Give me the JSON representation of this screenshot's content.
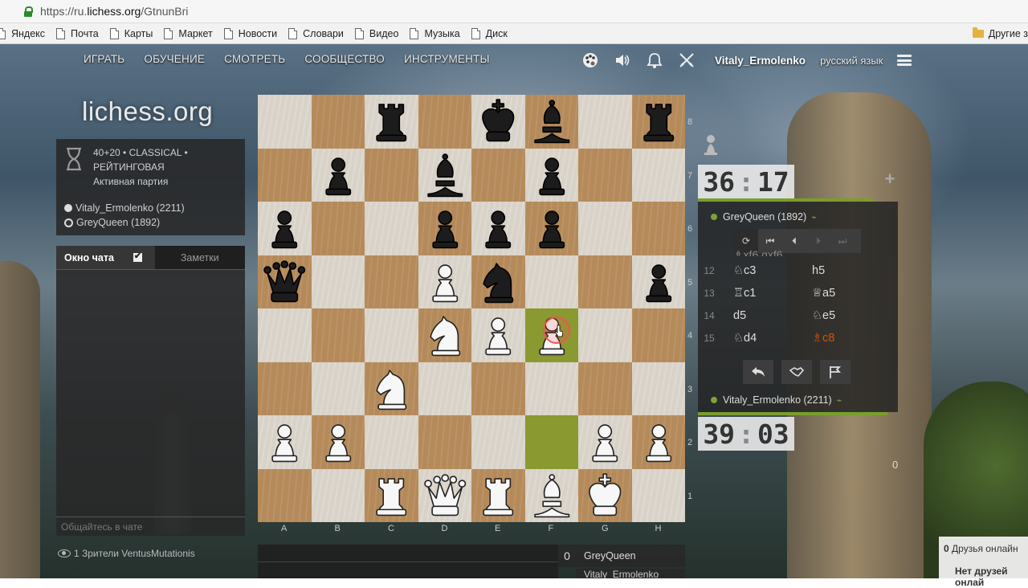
{
  "browser": {
    "url_scheme": "https://ru.",
    "url_host": "lichess.org",
    "url_path": "/GtnunBri",
    "bookmarks": [
      "Яндекс",
      "Почта",
      "Карты",
      "Маркет",
      "Новости",
      "Словари",
      "Видео",
      "Музыка",
      "Диск"
    ],
    "other_bookmarks": "Другие з"
  },
  "nav": {
    "items": [
      "ИГРАТЬ",
      "ОБУЧЕНИЕ",
      "СМОТРЕТЬ",
      "СООБЩЕСТВО",
      "ИНСТРУМЕНТЫ"
    ],
    "username": "Vitaly_Ermolenko",
    "language": "русский язык"
  },
  "logo": "lichess.org",
  "game_info": {
    "line1": "40+20 • CLASSICAL •",
    "line2": "РЕЙТИНГОВАЯ",
    "line3": "Активная партия",
    "white_player": "Vitaly_Ermolenko (2211)",
    "black_player": "GreyQueen (1892)"
  },
  "chat": {
    "tab_chat": "Окно чата",
    "tab_notes": "Заметки",
    "placeholder": "Общайтесь в чате",
    "watchers": "1 Зрители VentusMutationis"
  },
  "board": {
    "ranks": [
      "8",
      "7",
      "6",
      "5",
      "4",
      "3",
      "2",
      "1"
    ],
    "files": [
      "A",
      "B",
      "C",
      "D",
      "E",
      "F",
      "G",
      "H"
    ],
    "rows": [
      [
        "",
        "",
        "bR",
        "",
        "bK",
        "bB",
        "",
        "bR"
      ],
      [
        "",
        "bP",
        "",
        "bB",
        "",
        "bP",
        "",
        ""
      ],
      [
        "bP",
        "",
        "",
        "bP",
        "bP",
        "bP",
        "",
        ""
      ],
      [
        "bQ",
        "",
        "",
        "wP",
        "bN",
        "",
        "",
        "bP"
      ],
      [
        "",
        "",
        "",
        "wN",
        "wP",
        "wP",
        "",
        ""
      ],
      [
        "",
        "",
        "wN",
        "",
        "",
        "",
        "",
        ""
      ],
      [
        "wP",
        "wP",
        "",
        "",
        "",
        "",
        "wP",
        "wP"
      ],
      [
        "",
        "",
        "wR",
        "wQ",
        "wR",
        "wB",
        "wK",
        ""
      ]
    ],
    "highlights": [
      "f4",
      "f2"
    ]
  },
  "opponent": {
    "name": "GreyQueen (1892)",
    "clock_min": "36",
    "clock_sec": "17"
  },
  "me": {
    "name": "Vitaly_Ermolenko (2211)",
    "clock_min": "39",
    "clock_sec": "03"
  },
  "moves": [
    {
      "num": "12",
      "white": "♘c3",
      "black": "h5"
    },
    {
      "num": "13",
      "white": "♖c1",
      "black": "♕a5"
    },
    {
      "num": "14",
      "white": "d5",
      "black": "♘e5"
    },
    {
      "num": "15",
      "white": "♘d4",
      "black": "♗c8"
    }
  ],
  "partial_move_row": "♗xf6      gxf6",
  "right_zero": "0",
  "crosstable": {
    "score": "0",
    "name1": "GreyQueen",
    "name2": "Vitaly_Ermolenko"
  },
  "friends": {
    "count": "0",
    "label": "Друзья онлайн",
    "none": "Нет друзей онлай"
  },
  "colors": {
    "highlight": "#9aa43a",
    "current_move": "#d85000",
    "online": "#7ca33a"
  }
}
